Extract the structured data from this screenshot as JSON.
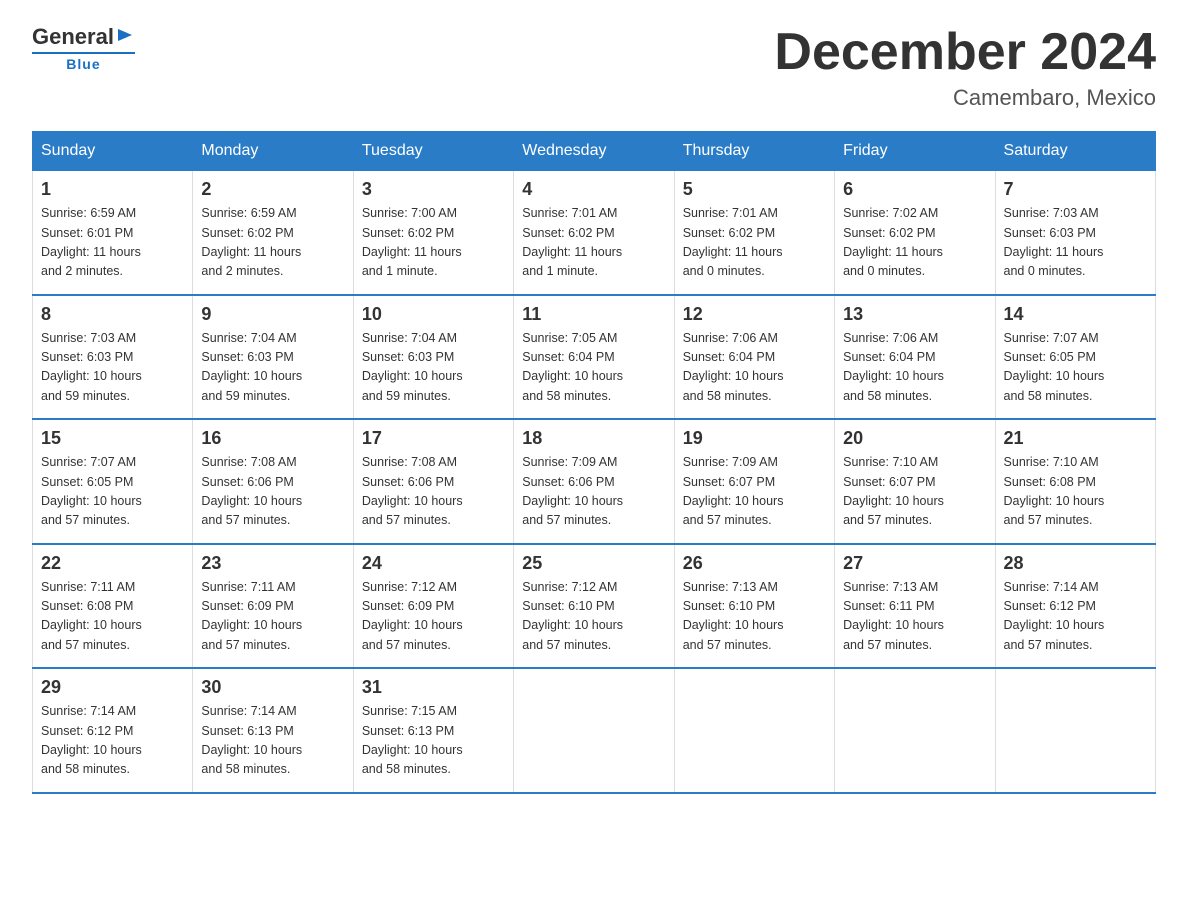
{
  "logo": {
    "general": "General",
    "blue": "Blue"
  },
  "header": {
    "title": "December 2024",
    "location": "Camembaro, Mexico"
  },
  "days_of_week": [
    "Sunday",
    "Monday",
    "Tuesday",
    "Wednesday",
    "Thursday",
    "Friday",
    "Saturday"
  ],
  "weeks": [
    [
      {
        "num": "1",
        "sunrise": "6:59 AM",
        "sunset": "6:01 PM",
        "daylight": "11 hours and 2 minutes."
      },
      {
        "num": "2",
        "sunrise": "6:59 AM",
        "sunset": "6:02 PM",
        "daylight": "11 hours and 2 minutes."
      },
      {
        "num": "3",
        "sunrise": "7:00 AM",
        "sunset": "6:02 PM",
        "daylight": "11 hours and 1 minute."
      },
      {
        "num": "4",
        "sunrise": "7:01 AM",
        "sunset": "6:02 PM",
        "daylight": "11 hours and 1 minute."
      },
      {
        "num": "5",
        "sunrise": "7:01 AM",
        "sunset": "6:02 PM",
        "daylight": "11 hours and 0 minutes."
      },
      {
        "num": "6",
        "sunrise": "7:02 AM",
        "sunset": "6:02 PM",
        "daylight": "11 hours and 0 minutes."
      },
      {
        "num": "7",
        "sunrise": "7:03 AM",
        "sunset": "6:03 PM",
        "daylight": "11 hours and 0 minutes."
      }
    ],
    [
      {
        "num": "8",
        "sunrise": "7:03 AM",
        "sunset": "6:03 PM",
        "daylight": "10 hours and 59 minutes."
      },
      {
        "num": "9",
        "sunrise": "7:04 AM",
        "sunset": "6:03 PM",
        "daylight": "10 hours and 59 minutes."
      },
      {
        "num": "10",
        "sunrise": "7:04 AM",
        "sunset": "6:03 PM",
        "daylight": "10 hours and 59 minutes."
      },
      {
        "num": "11",
        "sunrise": "7:05 AM",
        "sunset": "6:04 PM",
        "daylight": "10 hours and 58 minutes."
      },
      {
        "num": "12",
        "sunrise": "7:06 AM",
        "sunset": "6:04 PM",
        "daylight": "10 hours and 58 minutes."
      },
      {
        "num": "13",
        "sunrise": "7:06 AM",
        "sunset": "6:04 PM",
        "daylight": "10 hours and 58 minutes."
      },
      {
        "num": "14",
        "sunrise": "7:07 AM",
        "sunset": "6:05 PM",
        "daylight": "10 hours and 58 minutes."
      }
    ],
    [
      {
        "num": "15",
        "sunrise": "7:07 AM",
        "sunset": "6:05 PM",
        "daylight": "10 hours and 57 minutes."
      },
      {
        "num": "16",
        "sunrise": "7:08 AM",
        "sunset": "6:06 PM",
        "daylight": "10 hours and 57 minutes."
      },
      {
        "num": "17",
        "sunrise": "7:08 AM",
        "sunset": "6:06 PM",
        "daylight": "10 hours and 57 minutes."
      },
      {
        "num": "18",
        "sunrise": "7:09 AM",
        "sunset": "6:06 PM",
        "daylight": "10 hours and 57 minutes."
      },
      {
        "num": "19",
        "sunrise": "7:09 AM",
        "sunset": "6:07 PM",
        "daylight": "10 hours and 57 minutes."
      },
      {
        "num": "20",
        "sunrise": "7:10 AM",
        "sunset": "6:07 PM",
        "daylight": "10 hours and 57 minutes."
      },
      {
        "num": "21",
        "sunrise": "7:10 AM",
        "sunset": "6:08 PM",
        "daylight": "10 hours and 57 minutes."
      }
    ],
    [
      {
        "num": "22",
        "sunrise": "7:11 AM",
        "sunset": "6:08 PM",
        "daylight": "10 hours and 57 minutes."
      },
      {
        "num": "23",
        "sunrise": "7:11 AM",
        "sunset": "6:09 PM",
        "daylight": "10 hours and 57 minutes."
      },
      {
        "num": "24",
        "sunrise": "7:12 AM",
        "sunset": "6:09 PM",
        "daylight": "10 hours and 57 minutes."
      },
      {
        "num": "25",
        "sunrise": "7:12 AM",
        "sunset": "6:10 PM",
        "daylight": "10 hours and 57 minutes."
      },
      {
        "num": "26",
        "sunrise": "7:13 AM",
        "sunset": "6:10 PM",
        "daylight": "10 hours and 57 minutes."
      },
      {
        "num": "27",
        "sunrise": "7:13 AM",
        "sunset": "6:11 PM",
        "daylight": "10 hours and 57 minutes."
      },
      {
        "num": "28",
        "sunrise": "7:14 AM",
        "sunset": "6:12 PM",
        "daylight": "10 hours and 57 minutes."
      }
    ],
    [
      {
        "num": "29",
        "sunrise": "7:14 AM",
        "sunset": "6:12 PM",
        "daylight": "10 hours and 58 minutes."
      },
      {
        "num": "30",
        "sunrise": "7:14 AM",
        "sunset": "6:13 PM",
        "daylight": "10 hours and 58 minutes."
      },
      {
        "num": "31",
        "sunrise": "7:15 AM",
        "sunset": "6:13 PM",
        "daylight": "10 hours and 58 minutes."
      },
      null,
      null,
      null,
      null
    ]
  ],
  "labels": {
    "sunrise": "Sunrise:",
    "sunset": "Sunset:",
    "daylight": "Daylight:"
  }
}
